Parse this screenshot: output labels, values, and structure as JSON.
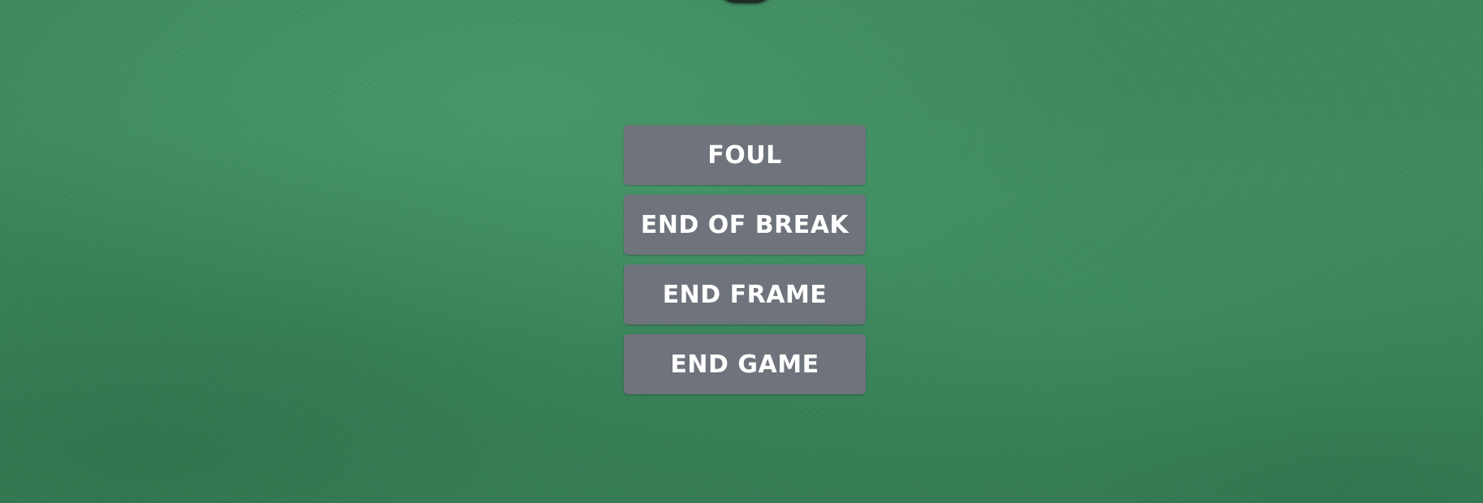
{
  "menu": {
    "buttons": [
      {
        "label": "FOUL"
      },
      {
        "label": "END OF BREAK"
      },
      {
        "label": "END FRAME"
      },
      {
        "label": "END GAME"
      }
    ]
  },
  "colors": {
    "felt": "#3a8a5c",
    "button_bg": "#6e737c",
    "button_text": "#ffffff",
    "ball": "#1f2b25"
  }
}
